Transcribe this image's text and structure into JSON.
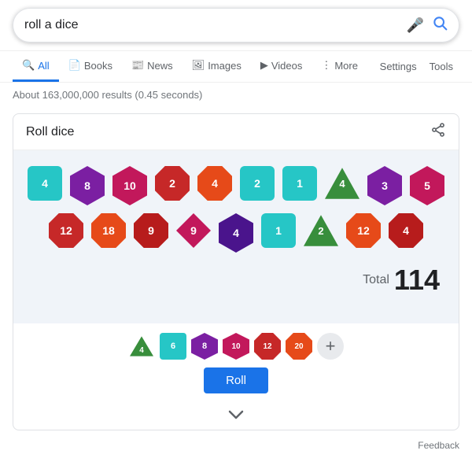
{
  "search": {
    "query": "roll a dice",
    "mic_label": "mic",
    "search_label": "search"
  },
  "nav": {
    "tabs": [
      {
        "label": "All",
        "icon": "🔍",
        "active": true
      },
      {
        "label": "Books",
        "icon": "📄",
        "active": false
      },
      {
        "label": "News",
        "icon": "📰",
        "active": false
      },
      {
        "label": "Images",
        "icon": "🖼",
        "active": false
      },
      {
        "label": "Videos",
        "icon": "▶",
        "active": false
      },
      {
        "label": "More",
        "icon": "⋮",
        "active": false
      }
    ],
    "settings": "Settings",
    "tools": "Tools"
  },
  "results": {
    "info": "About 163,000,000 results (0.45 seconds)"
  },
  "widget": {
    "title": "Roll dice",
    "share_icon": "share",
    "total_label": "Total",
    "total_value": "114",
    "roll_button": "Roll",
    "feedback": "Feedback",
    "expand_label": "expand",
    "dice": [
      {
        "shape": "square",
        "color": "teal",
        "value": "4"
      },
      {
        "shape": "hex",
        "color": "purple",
        "value": "8"
      },
      {
        "shape": "hex",
        "color": "magenta",
        "value": "10"
      },
      {
        "shape": "oct",
        "color": "red",
        "value": "2"
      },
      {
        "shape": "oct",
        "color": "orange",
        "value": "4"
      },
      {
        "shape": "square",
        "color": "teal",
        "value": "2"
      },
      {
        "shape": "square",
        "color": "teal",
        "value": "1"
      },
      {
        "shape": "triangle",
        "color": "green",
        "value": "4"
      },
      {
        "shape": "hex",
        "color": "purple",
        "value": "3"
      },
      {
        "shape": "hex",
        "color": "magenta",
        "value": "5"
      },
      {
        "shape": "oct",
        "color": "red",
        "value": "12"
      },
      {
        "shape": "oct",
        "color": "orange",
        "value": "18"
      },
      {
        "shape": "oct",
        "color": "dark-red",
        "value": "9"
      },
      {
        "shape": "diamond",
        "color": "magenta",
        "value": "9"
      },
      {
        "shape": "hex",
        "color": "dark-purple",
        "value": "4"
      },
      {
        "shape": "square",
        "color": "teal",
        "value": "1"
      },
      {
        "shape": "triangle",
        "color": "green",
        "value": "2"
      },
      {
        "shape": "oct",
        "color": "orange",
        "value": "12"
      },
      {
        "shape": "oct",
        "color": "dark-red",
        "value": "4"
      }
    ],
    "dice_types": [
      {
        "label": "4",
        "color": "green",
        "shape": "triangle"
      },
      {
        "label": "6",
        "color": "teal",
        "shape": "square"
      },
      {
        "label": "8",
        "color": "purple",
        "shape": "hex"
      },
      {
        "label": "10",
        "color": "magenta",
        "shape": "hex"
      },
      {
        "label": "12",
        "color": "red",
        "shape": "oct"
      },
      {
        "label": "20",
        "color": "orange",
        "shape": "oct"
      },
      {
        "label": "+",
        "color": "gray",
        "shape": "circle"
      }
    ]
  }
}
